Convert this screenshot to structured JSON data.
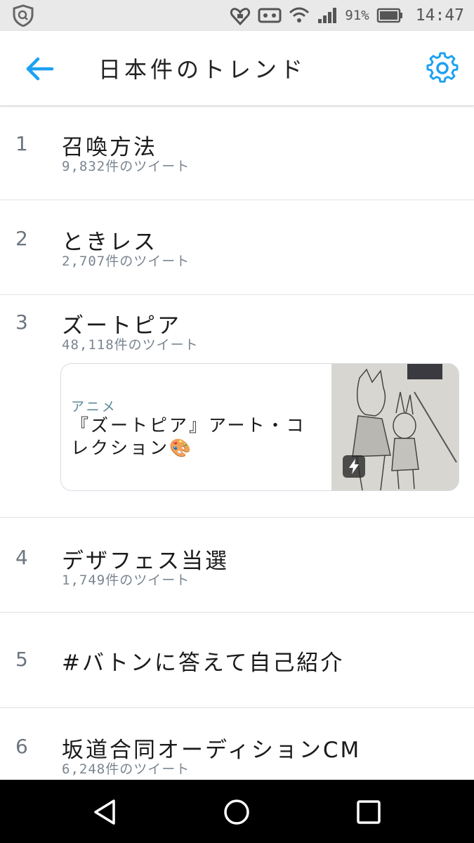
{
  "status_bar": {
    "battery": "91%",
    "time": "14:47"
  },
  "header": {
    "title": "日本件のトレンド"
  },
  "trends": [
    {
      "rank": "1",
      "name": "召喚方法",
      "count": "9,832件のツイート"
    },
    {
      "rank": "2",
      "name": "ときレス",
      "count": "2,707件のツイート"
    },
    {
      "rank": "3",
      "name": "ズートピア",
      "count": "48,118件のツイート",
      "card": {
        "category": "アニメ",
        "title": "『ズートピア』アート・コレクション🎨"
      }
    },
    {
      "rank": "4",
      "name": "デザフェス当選",
      "count": "1,749件のツイート"
    },
    {
      "rank": "5",
      "name": "#バトンに答えて自己紹介"
    },
    {
      "rank": "6",
      "name": "坂道合同オーディションCM",
      "count": "6,248件のツイート"
    }
  ],
  "colors": {
    "accent": "#1da1f2",
    "navbar": "#000000",
    "statusbar": "#e9e9e9"
  }
}
